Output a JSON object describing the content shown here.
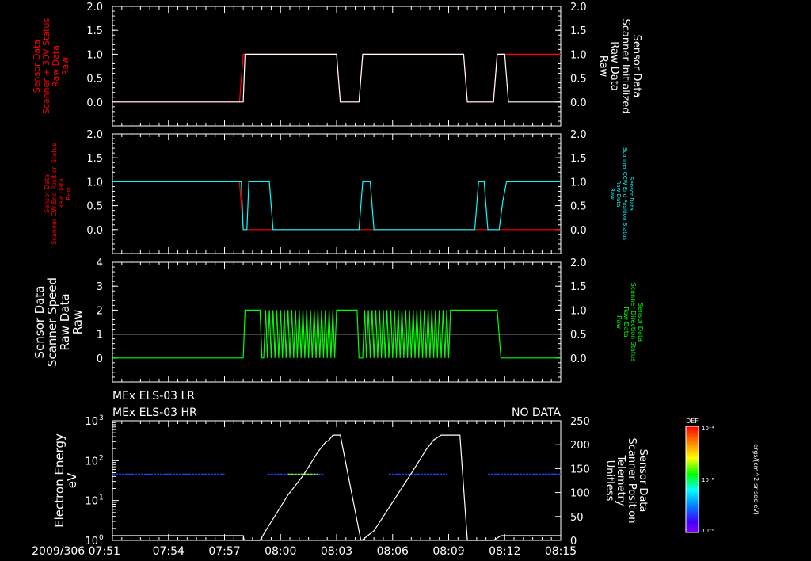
{
  "colors": {
    "background": "#000000",
    "axes": "#ffffff",
    "red": "#ff0000",
    "cyan": "#00ffff",
    "green": "#00ff00"
  },
  "time_axis": {
    "tick_labels": [
      "2009/306 07:51",
      "07:54",
      "07:57",
      "08:00",
      "08:03",
      "08:06",
      "08:09",
      "08:12",
      "08:15"
    ],
    "range_minutes": [
      0,
      24
    ]
  },
  "header": {
    "line1": "MEx ELS-03 LR",
    "line2": "MEx ELS-03 HR",
    "no_data": "NO DATA"
  },
  "colorbar": {
    "top_label": "DEF",
    "ticks": [
      "10⁻⁴",
      "10⁻⁵",
      "10⁻⁶"
    ],
    "unit": "ergs/(cm^2-sr-sec-eV)"
  },
  "chart_data": [
    {
      "type": "line",
      "panel": "1",
      "left_label": [
        "Sensor Data",
        "Scanner + 30V Status",
        "Raw Data",
        "Raw"
      ],
      "right_label": [
        "Sensor Data",
        "Scanner Initialized",
        "Raw Data",
        "Raw"
      ],
      "left_ticks": [
        "2.0",
        "1.5",
        "1.0",
        "0.5",
        "0.0"
      ],
      "right_ticks": [
        "2.0",
        "1.5",
        "1.0",
        "0.5",
        "0.0"
      ],
      "ylim": [
        -0.5,
        2.0
      ],
      "series": [
        {
          "color": "#ff0000",
          "x": [
            0,
            6.8,
            7.0,
            11.8,
            12.0,
            12.2,
            13.2,
            13.4,
            18.8,
            19.0,
            20.4,
            20.6,
            24
          ],
          "y": [
            0,
            0,
            1,
            1,
            1,
            0,
            0,
            1,
            1,
            0,
            0,
            1,
            1
          ]
        },
        {
          "color": "#ffffff",
          "x": [
            0,
            7.0,
            7.1,
            11.8,
            12.0,
            12.2,
            13.2,
            13.4,
            18.8,
            19.0,
            20.4,
            20.6,
            21.0,
            21.2,
            24
          ],
          "y": [
            0,
            0,
            1,
            1,
            1,
            0,
            0,
            1,
            1,
            0,
            0,
            1,
            1,
            0,
            0
          ]
        }
      ]
    },
    {
      "type": "line",
      "panel": "2",
      "left_label": [
        "Sensor Data",
        "Scanner CW End Position Status",
        "Raw Data",
        "Raw"
      ],
      "right_label": [
        "Sensor Data",
        "Scanner CCW End Position Status",
        "Raw Data",
        "Raw"
      ],
      "left_ticks": [
        "2.0",
        "1.5",
        "1.0",
        "0.5",
        "0.0"
      ],
      "right_ticks": [
        "2.0",
        "1.5",
        "1.0",
        "0.5",
        "0.0"
      ],
      "ylim": [
        -0.5,
        2.0
      ],
      "series": [
        {
          "color": "#ff0000",
          "x": [
            0,
            6.8,
            7.0,
            7.2,
            8.6,
            8.8,
            24
          ],
          "y": [
            1,
            1,
            0,
            0,
            0,
            0,
            0
          ]
        },
        {
          "color": "#00ffff",
          "x": [
            0,
            6.9,
            7.0,
            7.2,
            7.3,
            8.4,
            8.6,
            13.2,
            13.4,
            13.8,
            14.0,
            19.4,
            19.6,
            19.9,
            20.1,
            20.7,
            20.9,
            21.1,
            24
          ],
          "y": [
            1,
            1,
            0,
            0,
            1,
            1,
            0,
            0,
            1,
            1,
            0,
            0,
            1,
            1,
            0,
            0,
            0.6,
            1,
            1
          ]
        }
      ]
    },
    {
      "type": "line",
      "panel": "3",
      "left_label": [
        "Sensor Data",
        "Scanner Speed",
        "Raw Data",
        "Raw"
      ],
      "right_label": [
        "Sensor Data",
        "Scanner Direction Status",
        "Raw Data",
        "Raw"
      ],
      "left_ticks": [
        "4",
        "3",
        "2",
        "1",
        "0"
      ],
      "right_ticks": [
        "2.0",
        "1.5",
        "1.0",
        "0.5",
        "0.0"
      ],
      "ylim": [
        -1,
        4
      ],
      "series": [
        {
          "color": "#ffffff",
          "x": [
            0,
            24
          ],
          "y": [
            1,
            1
          ]
        },
        {
          "color": "#00ff00",
          "x": [
            0,
            7.0,
            7.1,
            7.9,
            8.0,
            8.1,
            8.2,
            8.3,
            8.4,
            8.5,
            8.6,
            8.7,
            8.8,
            8.9,
            9.0,
            9.1,
            9.2,
            9.3,
            9.4,
            9.5,
            9.6,
            9.7,
            9.8,
            9.9,
            10.0,
            10.1,
            10.2,
            10.3,
            10.4,
            10.5,
            10.6,
            10.7,
            10.8,
            10.9,
            11.0,
            11.1,
            11.2,
            11.3,
            11.4,
            11.5,
            11.6,
            11.7,
            11.8,
            11.9,
            12.0,
            13.1,
            13.2,
            13.4,
            13.5,
            13.6,
            13.7,
            13.8,
            13.9,
            14.0,
            14.1,
            14.2,
            14.3,
            14.4,
            14.5,
            14.6,
            14.7,
            14.8,
            14.9,
            15.0,
            15.1,
            15.2,
            15.3,
            15.4,
            15.5,
            15.6,
            15.7,
            15.8,
            15.9,
            16.0,
            16.1,
            16.2,
            16.3,
            16.4,
            16.5,
            16.6,
            16.7,
            16.8,
            16.9,
            17.0,
            17.1,
            17.2,
            17.3,
            17.4,
            17.5,
            17.6,
            17.7,
            17.8,
            17.9,
            18.0,
            18.1,
            20.6,
            20.8,
            24
          ],
          "y": [
            0,
            0,
            2,
            2,
            0,
            0,
            2,
            0,
            2,
            0,
            2,
            0,
            2,
            0,
            2,
            0,
            2,
            0,
            2,
            0,
            2,
            0,
            2,
            0,
            2,
            0,
            2,
            0,
            2,
            0,
            2,
            0,
            2,
            0,
            2,
            0,
            2,
            0,
            2,
            0,
            2,
            0,
            2,
            0,
            2,
            2,
            0,
            0,
            2,
            0,
            2,
            0,
            2,
            0,
            2,
            0,
            2,
            0,
            2,
            0,
            2,
            0,
            2,
            0,
            2,
            0,
            2,
            0,
            2,
            0,
            2,
            0,
            2,
            0,
            2,
            0,
            2,
            0,
            2,
            0,
            2,
            0,
            2,
            0,
            2,
            0,
            2,
            0,
            2,
            0,
            2,
            0,
            2,
            0,
            2,
            2,
            0,
            0
          ]
        }
      ]
    },
    {
      "type": "line",
      "panel": "4",
      "left_label": [
        "Electron Energy",
        "eV"
      ],
      "right_label": [
        "Sensor Data",
        "Scanner Position",
        "Telemetry",
        "Unitless"
      ],
      "left_ticks": [
        "10^3",
        "10^2",
        "10^1",
        "10^0"
      ],
      "right_ticks": [
        "250",
        "200",
        "150",
        "100",
        "50",
        "0"
      ],
      "right_range": [
        0,
        250
      ],
      "series": [
        {
          "name": "",
          "color": "#ffffff",
          "x": [
            0,
            7.0,
            7.05,
            7.9,
            8.2,
            8.6,
            9.0,
            9.4,
            9.8,
            10.2,
            10.6,
            11.0,
            11.4,
            11.6,
            11.8,
            12.0,
            12.2,
            13.3,
            13.35,
            14.0,
            14.5,
            15.0,
            15.5,
            16.0,
            16.4,
            16.8,
            17.2,
            17.6,
            17.8,
            18.0,
            18.2,
            18.4,
            18.6,
            19.0,
            20.4,
            20.8,
            24
          ],
          "y": [
            10,
            10,
            0,
            0,
            20,
            45,
            70,
            95,
            115,
            135,
            160,
            185,
            205,
            210,
            220,
            220,
            220,
            0,
            0,
            20,
            50,
            80,
            110,
            140,
            165,
            190,
            210,
            220,
            220,
            220,
            220,
            220,
            220,
            0,
            0,
            10,
            10
          ]
        }
      ],
      "spectrum_band_energy_eV": 45,
      "spectrum_segments": [
        {
          "x0": 0,
          "x1": 6.0,
          "color": "#2040ff"
        },
        {
          "x0": 8.3,
          "x1": 11.3,
          "color": "#2040ff"
        },
        {
          "x0": 9.4,
          "x1": 11.0,
          "color": "#80ff00"
        },
        {
          "x0": 14.8,
          "x1": 17.9,
          "color": "#2040ff"
        },
        {
          "x0": 23.9,
          "x1": 24,
          "color": "#2040ff"
        },
        {
          "x0": 23.0,
          "x1": 24,
          "color": "#2040ff"
        },
        {
          "x0": 20.1,
          "x1": 24,
          "color": "#2040ff"
        }
      ]
    }
  ]
}
